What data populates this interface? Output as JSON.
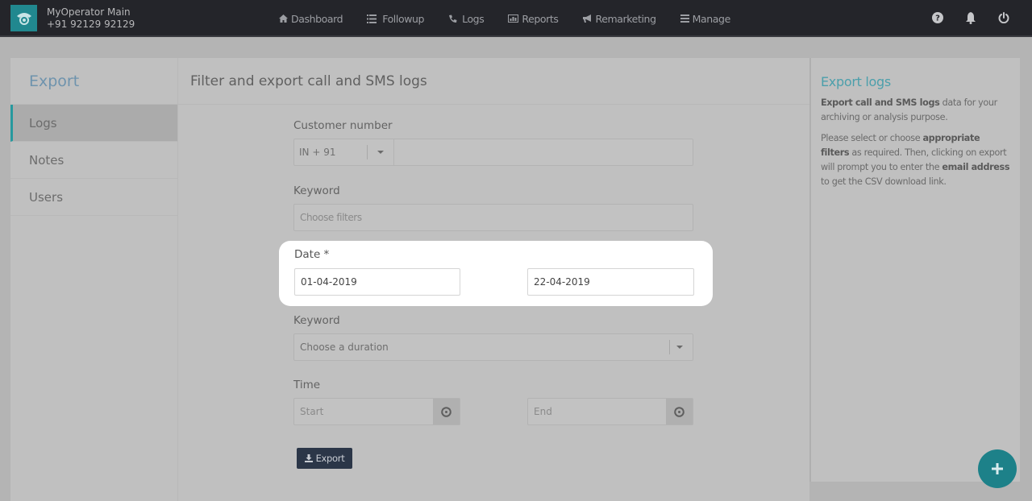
{
  "topbar": {
    "brand_name": "MyOperator Main",
    "brand_phone": "+91 92129 92129",
    "nav": [
      {
        "label": "Dashboard",
        "icon": "home-icon"
      },
      {
        "label": "Followup",
        "icon": "list-icon"
      },
      {
        "label": "Logs",
        "icon": "phone-icon"
      },
      {
        "label": "Reports",
        "icon": "chart-icon"
      },
      {
        "label": "Remarketing",
        "icon": "bullhorn-icon"
      },
      {
        "label": "Manage",
        "icon": "menu-icon"
      }
    ],
    "icons": [
      "help-icon",
      "bell-icon",
      "power-icon"
    ]
  },
  "sidebar": {
    "title": "Export",
    "items": [
      {
        "label": "Logs",
        "active": true
      },
      {
        "label": "Notes",
        "active": false
      },
      {
        "label": "Users",
        "active": false
      }
    ]
  },
  "main": {
    "header": "Filter and export call and SMS logs",
    "customer_number": {
      "label": "Customer number",
      "country_code": "IN + 91",
      "value": ""
    },
    "keyword_filter": {
      "label": "Keyword",
      "placeholder": "Choose filters"
    },
    "date": {
      "label": "Date *",
      "from": "01-04-2019",
      "to": "22-04-2019"
    },
    "duration": {
      "label": "Keyword",
      "selected": "Choose a duration"
    },
    "time": {
      "label": "Time",
      "start_placeholder": "Start",
      "end_placeholder": "End"
    },
    "export_label": "Export"
  },
  "info": {
    "title": "Export logs",
    "p1_bold": "Export call and SMS logs",
    "p1_rest": " data for your archiving or analysis purpose.",
    "p2_a": "Please select or choose ",
    "p2_bold1": "appropriate filters",
    "p2_b": " as required. Then, clicking on export will prompt you to enter the ",
    "p2_bold2": "email address",
    "p2_c": " to get the CSV download link."
  },
  "colors": {
    "accent": "#1d8189",
    "topbar": "#24252a",
    "export_button": "#2b3648"
  }
}
